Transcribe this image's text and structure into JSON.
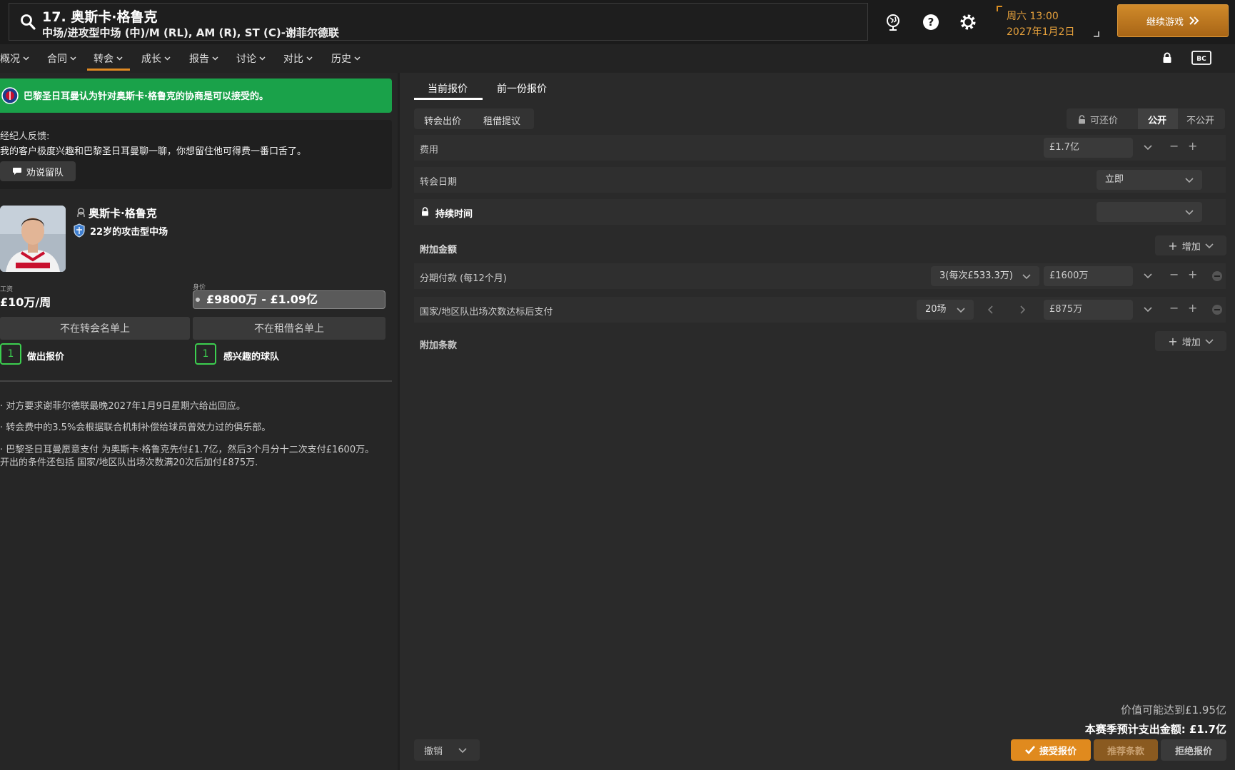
{
  "header": {
    "title": "17. 奥斯卡·格鲁克",
    "subtitle": "中场/进攻型中场 (中)/M (RL), AM (R), ST (C)-谢菲尔德联",
    "date_line1": "周六 13:00",
    "date_line2": "2027年1月2日",
    "continue_label": "继续游戏",
    "accent": "#e08a23"
  },
  "nav": {
    "items": [
      {
        "label": "概况"
      },
      {
        "label": "合同"
      },
      {
        "label": "转会"
      },
      {
        "label": "成长"
      },
      {
        "label": "报告"
      },
      {
        "label": "讨论"
      },
      {
        "label": "对比"
      },
      {
        "label": "历史"
      }
    ],
    "active": "转会"
  },
  "left": {
    "banner_text": "巴黎圣日耳曼认为针对奥斯卡·格鲁克的协商是可以接受的。",
    "banner_color": "#1aa24a",
    "agent_label": "经纪人反馈:",
    "agent_text": "我的客户极度兴趣和巴黎圣日耳曼聊一聊，你想留住他可得费一番口舌了。",
    "persuade_label": "劝说留队",
    "player_name": "奥斯卡·格鲁克",
    "player_desc": "22岁的攻击型中场",
    "wage_label": "工资",
    "wage_value": "£10万/周",
    "value_label": "身价",
    "value_range": "£9800万 - £1.09亿",
    "not_transfer_listed": "不在转会名单上",
    "not_loan_listed": "不在租借名单上",
    "offers_count": "1",
    "offers_label": "做出报价",
    "interested_count": "1",
    "interested_label": "感兴趣的球队",
    "notes": [
      "对方要求谢菲尔德联最晚2027年1月9日星期六给出回应。",
      "转会费中的3.5%会根据联合机制补偿给球员曾效力过的俱乐部。",
      "巴黎圣日耳曼愿意支付 为奥斯卡·格鲁克先付£1.7亿，然后3个月分十二次支付£1600万。",
      "开出的条件还包括 国家/地区队出场次数满20次后加付£875万."
    ]
  },
  "right": {
    "tabs": [
      "当前报价",
      "前一份报价"
    ],
    "offer_types": [
      "转会出价",
      "租借提议"
    ],
    "negotiable_label": "可还价",
    "public_label": "公开",
    "private_label": "不公开",
    "fee_label": "费用",
    "fee_value": "£1.7亿",
    "date_label": "转会日期",
    "date_value": "立即",
    "duration_label": "持续时间",
    "extra_label": "附加金额",
    "add_label": "增加",
    "installments_label": "分期付款 (每12个月)",
    "installments_value": "3(每次£533.3万)",
    "installments_amount": "£1600万",
    "caps_label": "国家/地区队出场次数达标后支付",
    "caps_value": "20场",
    "caps_amount": "£875万",
    "clauses_label": "附加条款",
    "potential_value": "价值可能达到£1.95亿",
    "season_spend": "本赛季预计支出金额: £1.7亿",
    "undo_label": "撤销",
    "accept_label": "接受报价",
    "suggest_label": "推荐条款",
    "reject_label": "拒绝报价"
  }
}
